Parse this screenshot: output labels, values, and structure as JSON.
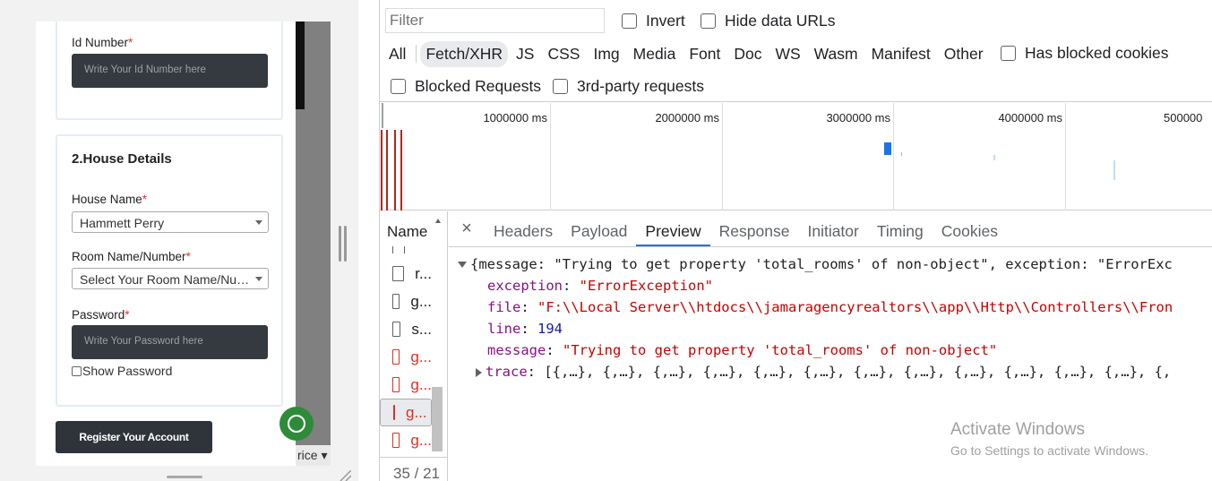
{
  "form": {
    "id_number_label": "Id Number",
    "id_number_placeholder": "Write Your Id Number here",
    "section_title": "2.House Details",
    "house_name_label": "House Name",
    "house_name_value": "Hammett Perry",
    "room_label": "Room Name/Number",
    "room_value": "Select Your Room Name/Number",
    "password_label": "Password",
    "password_placeholder": "Write Your Password here",
    "show_password_label": "Show Password",
    "required_mark": "*",
    "register_button": "Register Your Account",
    "price_select": "rice"
  },
  "devtools": {
    "filter_placeholder": "Filter",
    "invert_label": "Invert",
    "hide_data_urls_label": "Hide data URLs",
    "types": [
      "All",
      "Fetch/XHR",
      "JS",
      "CSS",
      "Img",
      "Media",
      "Font",
      "Doc",
      "WS",
      "Wasm",
      "Manifest",
      "Other"
    ],
    "active_type": "Fetch/XHR",
    "has_blocked_cookies_label": "Has blocked cookies",
    "blocked_requests_label": "Blocked Requests",
    "third_party_label": "3rd-party requests",
    "timeline_ticks": [
      "1000000 ms",
      "2000000 ms",
      "3000000 ms",
      "4000000 ms",
      "500000"
    ],
    "name_column": "Name",
    "requests": [
      {
        "name": "r...",
        "error": false
      },
      {
        "name": "g...",
        "error": false
      },
      {
        "name": "s...",
        "error": false
      },
      {
        "name": "g...",
        "error": true
      },
      {
        "name": "g...",
        "error": true
      },
      {
        "name": "g...",
        "error": true,
        "selected": true
      },
      {
        "name": "g...",
        "error": true
      }
    ],
    "list_footer": "35 / 21",
    "close_icon": "×",
    "detail_tabs": [
      "Headers",
      "Payload",
      "Preview",
      "Response",
      "Initiator",
      "Timing",
      "Cookies"
    ],
    "active_detail_tab": "Preview",
    "preview": {
      "summary": "{message: \"Trying to get property 'total_rooms' of non-object\", exception: \"ErrorExc",
      "exception_key": "exception",
      "exception_value": "\"ErrorException\"",
      "file_key": "file",
      "file_value": "\"F:\\\\Local Server\\\\htdocs\\\\jamaragencyrealtors\\\\app\\\\Http\\\\Controllers\\\\Fron",
      "line_key": "line",
      "line_value": "194",
      "message_key": "message",
      "message_value": "\"Trying to get property 'total_rooms' of non-object\"",
      "trace_key": "trace",
      "trace_value": "[{,…}, {,…}, {,…}, {,…}, {,…}, {,…}, {,…}, {,…}, {,…}, {,…}, {,…}, {,…}, {,"
    },
    "watermark_title": "Activate Windows",
    "watermark_sub": "Go to Settings to activate Windows."
  },
  "colors": {
    "active_tab_underline": "#1a73e8",
    "error_red": "#d93025",
    "dark_input": "#343a40"
  }
}
